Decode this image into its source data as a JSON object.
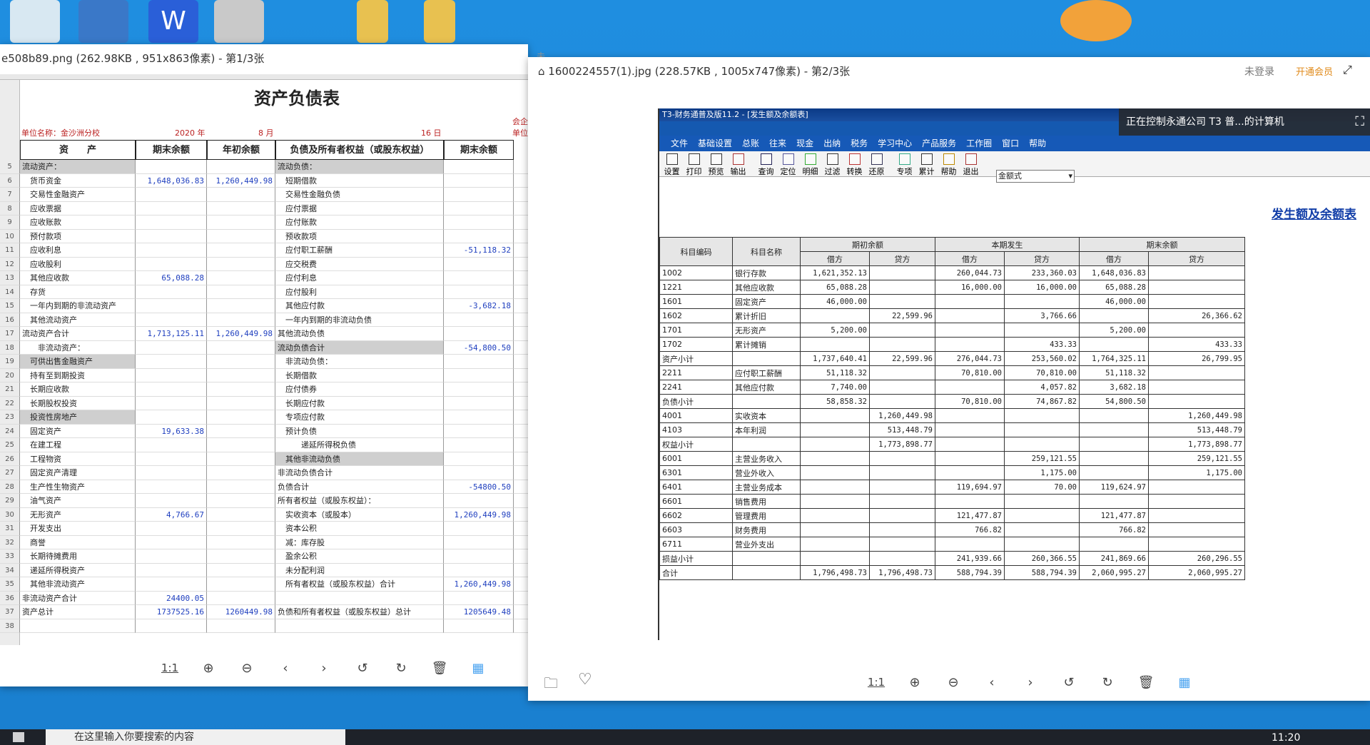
{
  "left_viewer": {
    "title": "e508b89.png (262.98KB , 951x863像素) - 第1/3张",
    "top_partial": "未登录  开通会员",
    "zoom_label": "1:1"
  },
  "right_viewer": {
    "title": "1600224557(1).jpg (228.57KB , 1005x747像素) - 第2/3张",
    "login": "未登录",
    "vip": "开通会员",
    "zoom_label": "1:1"
  },
  "remote_banner": "正在控制永通公司 T3 普...的计算机",
  "balance_sheet": {
    "title": "资产负债表",
    "unit": "单位名称：金沙洲分校",
    "year": "2020 年",
    "month": "8 月",
    "day": "16 日",
    "right_partial_1": "会企",
    "right_partial_2": "单位",
    "headers": [
      "资　　产",
      "期末余额",
      "年初余额",
      "负债及所有者权益（或股东权益）",
      "期末余额"
    ],
    "rows": [
      {
        "n": "5",
        "a": "流动资产：",
        "b": "",
        "c": "",
        "d": "流动负债：",
        "e": ""
      },
      {
        "n": "6",
        "a": "　货币资金",
        "b": "1,648,036.83",
        "c": "1,260,449.98",
        "d": "　短期借款",
        "e": ""
      },
      {
        "n": "7",
        "a": "　交易性金融资产",
        "b": "",
        "c": "",
        "d": "　交易性金融负债",
        "e": ""
      },
      {
        "n": "8",
        "a": "　应收票据",
        "b": "",
        "c": "",
        "d": "　应付票据",
        "e": ""
      },
      {
        "n": "9",
        "a": "　应收账款",
        "b": "",
        "c": "",
        "d": "　应付账款",
        "e": ""
      },
      {
        "n": "10",
        "a": "　预付款项",
        "b": "",
        "c": "",
        "d": "　预收款项",
        "e": ""
      },
      {
        "n": "11",
        "a": "　应收利息",
        "b": "",
        "c": "",
        "d": "　应付职工薪酬",
        "e": "-51,118.32"
      },
      {
        "n": "12",
        "a": "　应收股利",
        "b": "",
        "c": "",
        "d": "　应交税费",
        "e": ""
      },
      {
        "n": "13",
        "a": "　其他应收款",
        "b": "65,088.28",
        "c": "",
        "d": "　应付利息",
        "e": ""
      },
      {
        "n": "14",
        "a": "　存货",
        "b": "",
        "c": "",
        "d": "　应付股利",
        "e": ""
      },
      {
        "n": "15",
        "a": "　一年内到期的非流动资产",
        "b": "",
        "c": "",
        "d": "　其他应付款",
        "e": "-3,682.18"
      },
      {
        "n": "16",
        "a": "　其他流动资产",
        "b": "",
        "c": "",
        "d": "　一年内到期的非流动负债",
        "e": ""
      },
      {
        "n": "17",
        "a": "流动资产合计",
        "b": "1,713,125.11",
        "c": "1,260,449.98",
        "d": "其他流动负债",
        "e": ""
      },
      {
        "n": "18",
        "a": "　　非流动资产：",
        "b": "",
        "c": "",
        "d": "流动负债合计",
        "e": "-54,800.50"
      },
      {
        "n": "19",
        "a": "　可供出售金融资产",
        "b": "",
        "c": "",
        "d": "　非流动负债：",
        "e": ""
      },
      {
        "n": "20",
        "a": "　持有至到期投资",
        "b": "",
        "c": "",
        "d": "　长期借款",
        "e": ""
      },
      {
        "n": "21",
        "a": "　长期应收款",
        "b": "",
        "c": "",
        "d": "　应付债券",
        "e": ""
      },
      {
        "n": "22",
        "a": "　长期股权投资",
        "b": "",
        "c": "",
        "d": "　长期应付款",
        "e": ""
      },
      {
        "n": "23",
        "a": "　投资性房地产",
        "b": "",
        "c": "",
        "d": "　专项应付款",
        "e": ""
      },
      {
        "n": "24",
        "a": "　固定资产",
        "b": "19,633.38",
        "c": "",
        "d": "　预计负债",
        "e": ""
      },
      {
        "n": "25",
        "a": "　在建工程",
        "b": "",
        "c": "",
        "d": "　　　递延所得税负债",
        "e": ""
      },
      {
        "n": "26",
        "a": "　工程物资",
        "b": "",
        "c": "",
        "d": "　其他非流动负债",
        "e": ""
      },
      {
        "n": "27",
        "a": "　固定资产清理",
        "b": "",
        "c": "",
        "d": "非流动负债合计",
        "e": ""
      },
      {
        "n": "28",
        "a": "　生产性生物资产",
        "b": "",
        "c": "",
        "d": "负债合计",
        "e": "-54800.50"
      },
      {
        "n": "29",
        "a": "　油气资产",
        "b": "",
        "c": "",
        "d": "所有者权益（或股东权益）：",
        "e": ""
      },
      {
        "n": "30",
        "a": "　无形资产",
        "b": "4,766.67",
        "c": "",
        "d": "　实收资本（或股本）",
        "e": "1,260,449.98"
      },
      {
        "n": "31",
        "a": "　开发支出",
        "b": "",
        "c": "",
        "d": "　资本公积",
        "e": ""
      },
      {
        "n": "32",
        "a": "　商誉",
        "b": "",
        "c": "",
        "d": "　减：库存股",
        "e": ""
      },
      {
        "n": "33",
        "a": "　长期待摊费用",
        "b": "",
        "c": "",
        "d": "　盈余公积",
        "e": ""
      },
      {
        "n": "34",
        "a": "　递延所得税资产",
        "b": "",
        "c": "",
        "d": "　未分配利润",
        "e": ""
      },
      {
        "n": "35",
        "a": "　其他非流动资产",
        "b": "",
        "c": "",
        "d": "　所有者权益（或股东权益）合计",
        "e": "1,260,449.98"
      },
      {
        "n": "36",
        "a": "非流动资产合计",
        "b": "24400.05",
        "c": "",
        "d": "",
        "e": ""
      },
      {
        "n": "37",
        "a": "资产总计",
        "b": "1737525.16",
        "c": "1260449.98",
        "d": "负债和所有者权益（或股东权益）总计",
        "e": "1205649.48"
      },
      {
        "n": "38",
        "a": "",
        "b": "",
        "c": "",
        "d": "",
        "e": ""
      }
    ]
  },
  "t3": {
    "title": "T3-财务通普及版11.2 - [发生额及余额表]",
    "menu": [
      "文件",
      "基础设置",
      "总账",
      "往来",
      "现金",
      "出纳",
      "税务",
      "学习中心",
      "产品服务",
      "工作圈",
      "窗口",
      "帮助"
    ],
    "tools": [
      "设置",
      "打印",
      "预览",
      "输出",
      "查询",
      "定位",
      "明细",
      "过滤",
      "转换",
      "还原",
      "专项",
      "累计",
      "帮助",
      "退出"
    ],
    "combo": "金额式",
    "report_title": "发生额及余额表",
    "headers": {
      "code": "科目编码",
      "name": "科目名称",
      "g1": "期初余额",
      "g2": "本期发生",
      "g3": "期末余额",
      "dr": "借方",
      "cr": "贷方"
    },
    "rows": [
      [
        "1002",
        "银行存款",
        "1,621,352.13",
        "",
        "260,044.73",
        "233,360.03",
        "1,648,036.83",
        ""
      ],
      [
        "1221",
        "其他应收款",
        "65,088.28",
        "",
        "16,000.00",
        "16,000.00",
        "65,088.28",
        ""
      ],
      [
        "1601",
        "固定资产",
        "46,000.00",
        "",
        "",
        "",
        "46,000.00",
        ""
      ],
      [
        "1602",
        "累计折旧",
        "",
        "22,599.96",
        "",
        "3,766.66",
        "",
        "26,366.62"
      ],
      [
        "1701",
        "无形资产",
        "5,200.00",
        "",
        "",
        "",
        "5,200.00",
        ""
      ],
      [
        "1702",
        "累计摊销",
        "",
        "",
        "",
        "433.33",
        "",
        "433.33"
      ],
      [
        "资产小计",
        "",
        "1,737,640.41",
        "22,599.96",
        "276,044.73",
        "253,560.02",
        "1,764,325.11",
        "26,799.95"
      ],
      [
        "2211",
        "应付职工薪酬",
        "51,118.32",
        "",
        "70,810.00",
        "70,810.00",
        "51,118.32",
        ""
      ],
      [
        "2241",
        "其他应付款",
        "7,740.00",
        "",
        "",
        "4,057.82",
        "3,682.18",
        ""
      ],
      [
        "负债小计",
        "",
        "58,858.32",
        "",
        "70,810.00",
        "74,867.82",
        "54,800.50",
        ""
      ],
      [
        "4001",
        "实收资本",
        "",
        "1,260,449.98",
        "",
        "",
        "",
        "1,260,449.98"
      ],
      [
        "4103",
        "本年利润",
        "",
        "513,448.79",
        "",
        "",
        "",
        "513,448.79"
      ],
      [
        "权益小计",
        "",
        "",
        "1,773,898.77",
        "",
        "",
        "",
        "1,773,898.77"
      ],
      [
        "6001",
        "主营业务收入",
        "",
        "",
        "",
        "259,121.55",
        "",
        "259,121.55"
      ],
      [
        "6301",
        "营业外收入",
        "",
        "",
        "",
        "1,175.00",
        "",
        "1,175.00"
      ],
      [
        "6401",
        "主营业务成本",
        "",
        "",
        "119,694.97",
        "70.00",
        "119,624.97",
        ""
      ],
      [
        "6601",
        "销售费用",
        "",
        "",
        "",
        "",
        "",
        ""
      ],
      [
        "6602",
        "管理费用",
        "",
        "",
        "121,477.87",
        "",
        "121,477.87",
        ""
      ],
      [
        "6603",
        "财务费用",
        "",
        "",
        "766.82",
        "",
        "766.82",
        ""
      ],
      [
        "6711",
        "营业外支出",
        "",
        "",
        "",
        "",
        "",
        ""
      ],
      [
        "损益小计",
        "",
        "",
        "",
        "241,939.66",
        "260,366.55",
        "241,869.66",
        "260,296.55"
      ],
      [
        "合计",
        "",
        "1,796,498.73",
        "1,796,498.73",
        "588,794.39",
        "588,794.39",
        "2,060,995.27",
        "2,060,995.27"
      ]
    ]
  },
  "taskbar": {
    "search": "在这里输入你要搜索的内容",
    "time": "11:20"
  }
}
